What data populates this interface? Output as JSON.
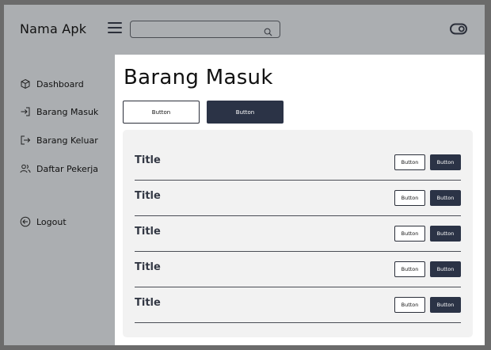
{
  "app": {
    "name": "Nama Apk"
  },
  "header": {
    "search": {
      "value": "",
      "placeholder": ""
    },
    "icons": {
      "menu": "hamburger-icon",
      "search": "search-icon",
      "toggle": "toggle-icon"
    }
  },
  "sidebar": {
    "items": [
      {
        "label": "Dashboard",
        "icon": "box-icon"
      },
      {
        "label": "Barang Masuk",
        "icon": "login-arrow-icon"
      },
      {
        "label": "Barang Keluar",
        "icon": "logout-arrow-icon"
      },
      {
        "label": "Daftar Pekerja",
        "icon": "users-icon"
      }
    ],
    "logout": {
      "label": "Logout",
      "icon": "circle-arrow-left-icon"
    }
  },
  "main": {
    "title": "Barang Masuk",
    "actions": [
      {
        "label": "Button"
      },
      {
        "label": "Button"
      }
    ],
    "rows": [
      {
        "title": "Title",
        "buttons": [
          "Button",
          "Button"
        ]
      },
      {
        "title": "Title",
        "buttons": [
          "Button",
          "Button"
        ]
      },
      {
        "title": "Title",
        "buttons": [
          "Button",
          "Button"
        ]
      },
      {
        "title": "Title",
        "buttons": [
          "Button",
          "Button"
        ]
      },
      {
        "title": "Title",
        "buttons": [
          "Button",
          "Button"
        ]
      }
    ]
  },
  "colors": {
    "background": "#abaeb1",
    "content": "#ffffff",
    "card": "#f2f2f2",
    "dark_button": "#2b3346",
    "outer": "#6b6b6b"
  }
}
